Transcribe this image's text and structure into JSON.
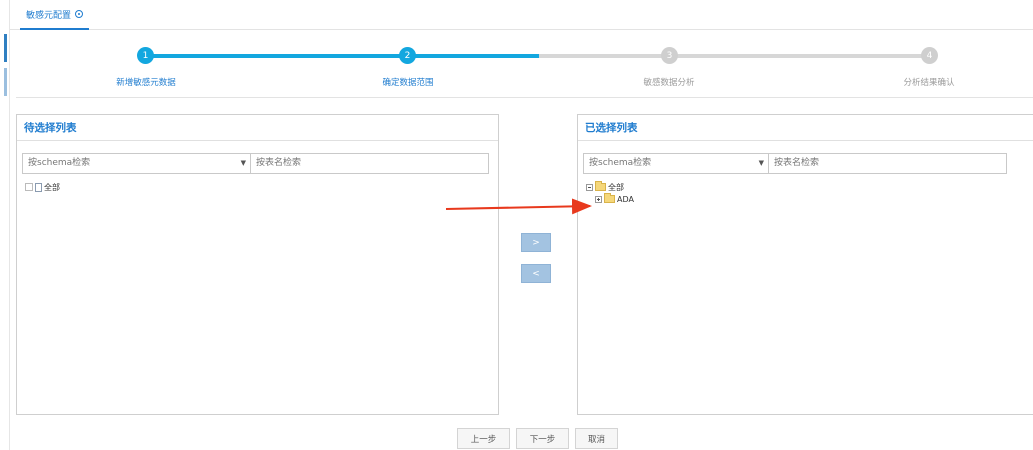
{
  "tab": {
    "label": "敏感元配置"
  },
  "steps": [
    {
      "num": "1",
      "label": "新增敏感元数据",
      "state": "done"
    },
    {
      "num": "2",
      "label": "确定数据范围",
      "state": "done"
    },
    {
      "num": "3",
      "label": "敏感数据分析",
      "state": "todo"
    },
    {
      "num": "4",
      "label": "分析结果确认",
      "state": "todo"
    }
  ],
  "left_panel": {
    "title": "待选择列表",
    "schema_placeholder": "按schema检索",
    "table_placeholder": "按表名检索",
    "tree": [
      {
        "label": "全部"
      }
    ]
  },
  "right_panel": {
    "title": "已选择列表",
    "schema_placeholder": "按schema检索",
    "table_placeholder": "按表名检索",
    "tree": [
      {
        "label": "全部"
      },
      {
        "label": "ADA"
      }
    ]
  },
  "move_buttons": {
    "add": ">",
    "remove": "<"
  },
  "footer": {
    "prev": "上一步",
    "next": "下一步",
    "cancel": "取消"
  },
  "colors": {
    "accent": "#1f7ccf",
    "progress": "#13a7df",
    "annotation_arrow": "#e8391d"
  },
  "icons": {
    "tab_close": "close-circle-icon",
    "dropdown": "chevron-down-icon",
    "folder": "folder-icon",
    "document": "document-icon"
  }
}
